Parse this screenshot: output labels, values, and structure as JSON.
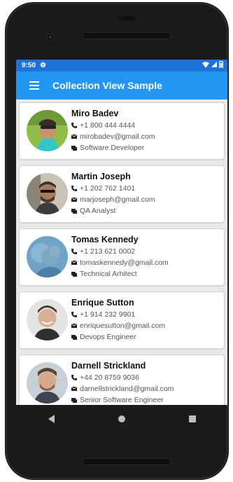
{
  "status_bar": {
    "time": "9:50"
  },
  "toolbar": {
    "title": "Collection View Sample"
  },
  "contacts": [
    {
      "name": "Miro Badev",
      "phone": "+1 800 444 4444",
      "email": "mirobadev@gmail.com",
      "role": "Software Developer"
    },
    {
      "name": "Martin Joseph",
      "phone": "+1 202 762 1401",
      "email": "marjoseph@gmail.com",
      "role": "QA Analyst"
    },
    {
      "name": "Tomas Kennedy",
      "phone": "+1 213 621 0002",
      "email": "tomaskennedy@gmail.com",
      "role": "Technical Arhitect"
    },
    {
      "name": "Enrique Sutton",
      "phone": "+1 914 232 9901",
      "email": "enriquesutton@gmail.com",
      "role": "Devops Engineer"
    },
    {
      "name": "Darnell Strickland",
      "phone": "+44 20 8759 9036",
      "email": "darnellstrickland@gmail.com",
      "role": "Senior Software Engineer"
    }
  ],
  "icons": {
    "phone": "phone-icon",
    "email": "email-icon",
    "role": "badge-icon",
    "menu": "hamburger-icon"
  },
  "colors": {
    "status_bar": "#1c72d6",
    "toolbar": "#2196f3",
    "card": "#ffffff",
    "background": "#e9e9e9"
  }
}
